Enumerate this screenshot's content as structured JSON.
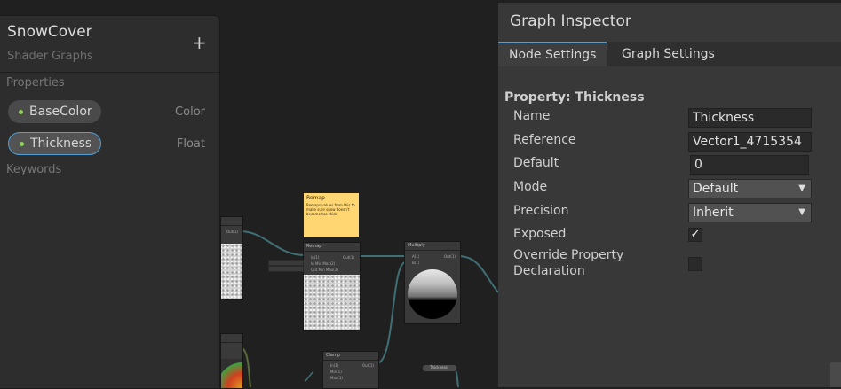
{
  "blackboard": {
    "title": "SnowCover",
    "subtitle": "Shader Graphs",
    "add_label": "+",
    "properties_label": "Properties",
    "keywords_label": "Keywords",
    "properties": [
      {
        "name": "BaseColor",
        "type": "Color",
        "selected": false
      },
      {
        "name": "Thickness",
        "type": "Float",
        "selected": true
      }
    ]
  },
  "graph": {
    "sticky_title": "Remap",
    "sticky_body": "Remaps values from this to make sure snow doesn't become too thick",
    "nodes": [
      {
        "title": "Remap",
        "inputs": [
          "In(1)",
          "In Min Max(2)",
          "Out Min Max(2)"
        ],
        "output": "Out(1)"
      },
      {
        "title": "Multiply",
        "inputs": [
          "A(1)",
          "B(1)"
        ],
        "output": "Out(1)"
      },
      {
        "title": "Clamp",
        "inputs": [
          "In(1)",
          "Min(1)",
          "Max(1)"
        ],
        "output": "Out(1)"
      },
      {
        "title": "",
        "inputs": [],
        "output": "Out(1)"
      }
    ],
    "property_node_label": "Thickness"
  },
  "inspector": {
    "title": "Graph Inspector",
    "tabs": [
      {
        "label": "Node Settings",
        "active": true
      },
      {
        "label": "Graph Settings",
        "active": false
      }
    ],
    "property_header": "Property: Thickness",
    "rows": {
      "name_label": "Name",
      "name_value": "Thickness",
      "reference_label": "Reference",
      "reference_value": "Vector1_4715354",
      "default_label": "Default",
      "default_value": "0",
      "mode_label": "Mode",
      "mode_value": "Default",
      "precision_label": "Precision",
      "precision_value": "Inherit",
      "exposed_label": "Exposed",
      "exposed_value": "✓",
      "override_label_1": "Override Property",
      "override_label_2": "Declaration"
    }
  },
  "colors": {
    "accent": "#4f9fd6",
    "float_dot": "#8ed05a",
    "sticky": "#ffd672",
    "edge": "#3f6f73"
  }
}
